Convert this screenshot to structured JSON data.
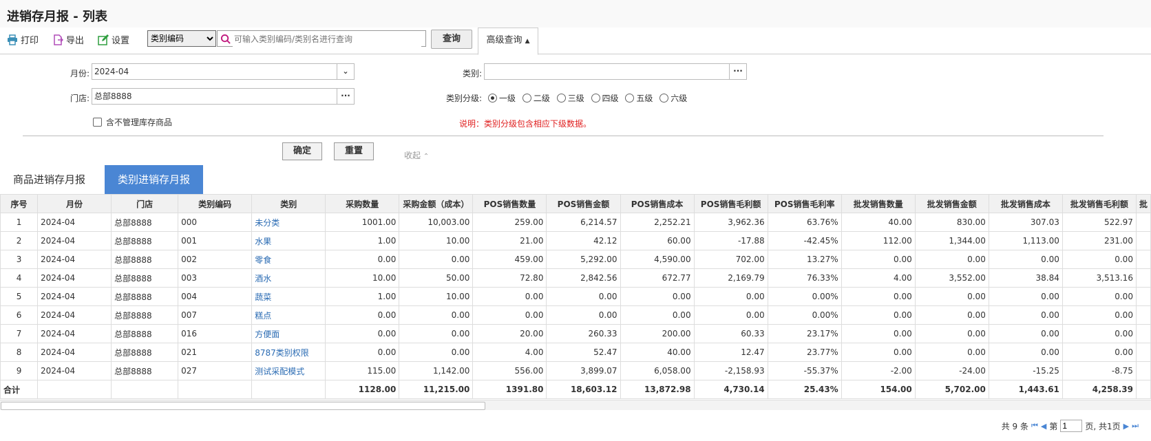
{
  "window": {
    "title": "进销存月报 - 列表"
  },
  "toolbar": {
    "print_label": "打印",
    "export_label": "导出",
    "settings_label": "设置",
    "field_select": "类别编码",
    "search_placeholder": "可输入类别编码/类别名进行查询",
    "query_label": "查询",
    "advanced_label": "高级查询"
  },
  "form": {
    "month_label": "月份:",
    "month_value": "2024-04",
    "store_label": "门店:",
    "store_value": "总部8888",
    "nonstock_label": "含不管理库存商品",
    "category_label": "类别:",
    "category_value": "",
    "level_label": "类别分级:",
    "levels": [
      "一级",
      "二级",
      "三级",
      "四级",
      "五级",
      "六级"
    ],
    "selected_level": "一级",
    "note": "说明：类别分级包含相应下级数据。",
    "confirm_label": "确定",
    "reset_label": "重置",
    "collapse_label": "收起"
  },
  "tabs": [
    {
      "label": "商品进销存月报",
      "active": false
    },
    {
      "label": "类别进销存月报",
      "active": true
    }
  ],
  "table": {
    "headers": [
      "序号",
      "月份",
      "门店",
      "类别编码",
      "类别",
      "采购数量",
      "采购金额（成本）",
      "POS销售数量",
      "POS销售金额",
      "POS销售成本",
      "POS销售毛利额",
      "POS销售毛利率",
      "批发销售数量",
      "批发销售金额",
      "批发销售成本",
      "批发销售毛利额",
      "批"
    ],
    "rows": [
      [
        "1",
        "2024-04",
        "总部8888",
        "000",
        "未分类",
        "1001.00",
        "10,003.00",
        "259.00",
        "6,214.57",
        "2,252.21",
        "3,962.36",
        "63.76%",
        "40.00",
        "830.00",
        "307.03",
        "522.97"
      ],
      [
        "2",
        "2024-04",
        "总部8888",
        "001",
        "水果",
        "1.00",
        "10.00",
        "21.00",
        "42.12",
        "60.00",
        "-17.88",
        "-42.45%",
        "112.00",
        "1,344.00",
        "1,113.00",
        "231.00"
      ],
      [
        "3",
        "2024-04",
        "总部8888",
        "002",
        "零食",
        "0.00",
        "0.00",
        "459.00",
        "5,292.00",
        "4,590.00",
        "702.00",
        "13.27%",
        "0.00",
        "0.00",
        "0.00",
        "0.00"
      ],
      [
        "4",
        "2024-04",
        "总部8888",
        "003",
        "酒水",
        "10.00",
        "50.00",
        "72.80",
        "2,842.56",
        "672.77",
        "2,169.79",
        "76.33%",
        "4.00",
        "3,552.00",
        "38.84",
        "3,513.16"
      ],
      [
        "5",
        "2024-04",
        "总部8888",
        "004",
        "蔬菜",
        "1.00",
        "10.00",
        "0.00",
        "0.00",
        "0.00",
        "0.00",
        "0.00%",
        "0.00",
        "0.00",
        "0.00",
        "0.00"
      ],
      [
        "6",
        "2024-04",
        "总部8888",
        "007",
        "糕点",
        "0.00",
        "0.00",
        "0.00",
        "0.00",
        "0.00",
        "0.00",
        "0.00%",
        "0.00",
        "0.00",
        "0.00",
        "0.00"
      ],
      [
        "7",
        "2024-04",
        "总部8888",
        "016",
        "方便面",
        "0.00",
        "0.00",
        "20.00",
        "260.33",
        "200.00",
        "60.33",
        "23.17%",
        "0.00",
        "0.00",
        "0.00",
        "0.00"
      ],
      [
        "8",
        "2024-04",
        "总部8888",
        "021",
        "8787类别权限",
        "0.00",
        "0.00",
        "4.00",
        "52.47",
        "40.00",
        "12.47",
        "23.77%",
        "0.00",
        "0.00",
        "0.00",
        "0.00"
      ],
      [
        "9",
        "2024-04",
        "总部8888",
        "027",
        "测试采配模式",
        "115.00",
        "1,142.00",
        "556.00",
        "3,899.07",
        "6,058.00",
        "-2,158.93",
        "-55.37%",
        "-2.00",
        "-24.00",
        "-15.25",
        "-8.75"
      ]
    ],
    "total": [
      "合计",
      "",
      "",
      "",
      "",
      "1128.00",
      "11,215.00",
      "1391.80",
      "18,603.12",
      "13,872.98",
      "4,730.14",
      "25.43%",
      "154.00",
      "5,702.00",
      "1,443.61",
      "4,258.39"
    ]
  },
  "pager": {
    "total_text": "共 9 条",
    "page_prefix": "第",
    "page_value": "1",
    "page_suffix": "页, 共1页"
  },
  "colors": {
    "accent": "#4a86d4",
    "link": "#2a6bb3",
    "note": "#e02020"
  }
}
